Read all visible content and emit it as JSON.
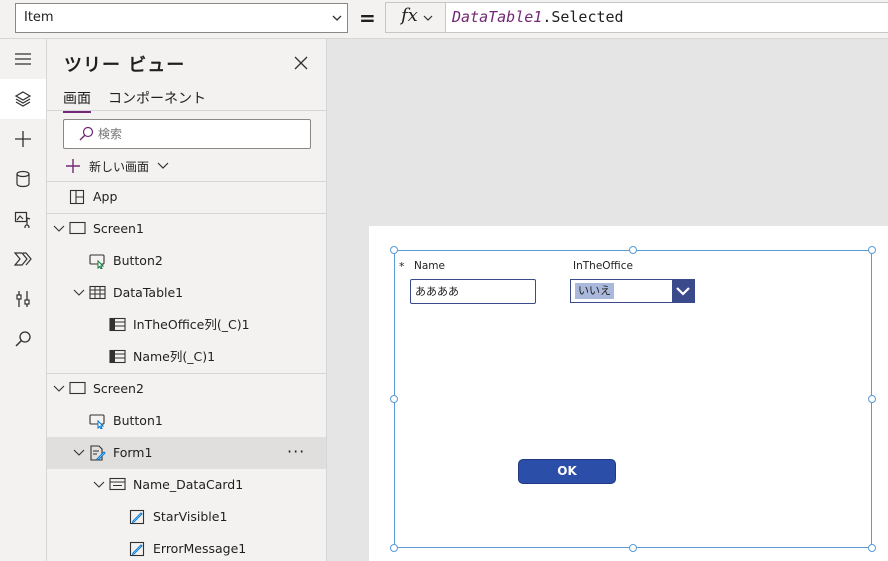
{
  "formula_bar": {
    "property": "Item",
    "equals": "=",
    "fx_label": "fx",
    "formula_ref": "DataTable1",
    "formula_prop": ".Selected"
  },
  "rail": {
    "icons": [
      "menu-icon",
      "layers-icon",
      "add-icon",
      "database-icon",
      "media-icon",
      "power-automate-icon",
      "tools-icon",
      "search-icon"
    ],
    "active_index": 1
  },
  "tree": {
    "title": "ツリー ビュー",
    "tabs": [
      {
        "label": "画面",
        "selected": true
      },
      {
        "label": "コンポーネント",
        "selected": false
      }
    ],
    "search_placeholder": "検索",
    "new_screen_label": "新しい画面",
    "more_label": "···",
    "nodes": [
      {
        "label": "App",
        "icon": "app-icon"
      },
      {
        "label": "Screen1",
        "icon": "screen-icon",
        "expanded": true
      },
      {
        "label": "Button2",
        "icon": "button-icon"
      },
      {
        "label": "DataTable1",
        "icon": "table-icon",
        "expanded": true
      },
      {
        "label": "InTheOffice列(_C)1",
        "icon": "column-icon"
      },
      {
        "label": "Name列(_C)1",
        "icon": "column-icon"
      },
      {
        "label": "Screen2",
        "icon": "screen-icon",
        "expanded": true
      },
      {
        "label": "Button1",
        "icon": "button-icon"
      },
      {
        "label": "Form1",
        "icon": "form-icon",
        "expanded": true,
        "selected": true
      },
      {
        "label": "Name_DataCard1",
        "icon": "datacard-icon",
        "expanded": true
      },
      {
        "label": "StarVisible1",
        "icon": "edit-label-icon"
      },
      {
        "label": "ErrorMessage1",
        "icon": "edit-label-icon"
      }
    ]
  },
  "canvas": {
    "required_mark": "*",
    "name_label": "Name",
    "name_value": "ああああ",
    "office_label": "InTheOffice",
    "office_value": "いいえ",
    "ok_label": "OK"
  },
  "colors": {
    "accent": "#742774",
    "selection": "#5b9bd5",
    "control_primary": "#3a4a8a",
    "button_fill": "#2b4ea8"
  }
}
